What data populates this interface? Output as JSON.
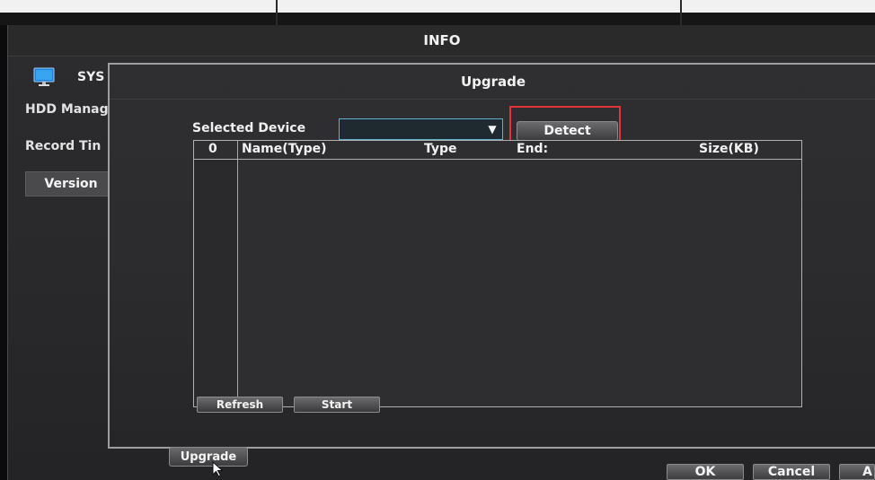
{
  "window": {
    "title": "INFO"
  },
  "sidebar": {
    "header": "SYS",
    "items": [
      {
        "label": "HDD Manag"
      },
      {
        "label": "Record Tin"
      },
      {
        "label": "Version"
      }
    ]
  },
  "dialog": {
    "title": "Upgrade",
    "device_label": "Selected Device",
    "device_value": "",
    "detect_label": "Detect",
    "columns": [
      "0",
      "Name(Type)",
      "Type",
      "End:",
      "Size(KB)"
    ],
    "refresh_label": "Refresh",
    "start_label": "Start"
  },
  "footer": {
    "upgrade_label": "Upgrade",
    "ok_label": "OK",
    "cancel_label": "Cancel",
    "apply_label": "A"
  },
  "colors": {
    "highlight_box": "#e2323a",
    "select_border": "#5fb0c9"
  },
  "icons": {
    "system": "monitor-icon",
    "dropdown": "dropdown-arrow-icon",
    "pointer": "mouse-cursor-icon"
  }
}
